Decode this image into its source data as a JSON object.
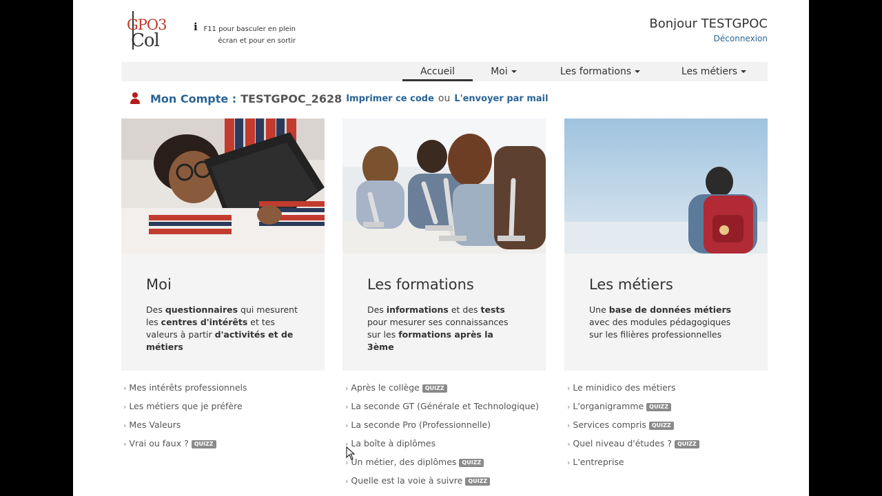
{
  "logo": {
    "line1": "GPO3",
    "line2": "Col"
  },
  "info": {
    "icon": "info-icon",
    "text": "F11 pour basculer en plein écran et pour en sortir"
  },
  "user": {
    "greeting": "Bonjour TESTGPOC",
    "logout_label": "Déconnexion"
  },
  "nav": {
    "accueil": "Accueil",
    "moi": "Moi",
    "formations": "Les formations",
    "metiers": "Les métiers"
  },
  "account": {
    "label": "Mon Compte :",
    "code": "TESTGPOC_2628",
    "print_link": "Imprimer ce code",
    "or": "ou",
    "mail_link": "L'envoyer par mail"
  },
  "cards": [
    {
      "title": "Moi",
      "desc": [
        {
          "t": "Des ",
          "b": false
        },
        {
          "t": "questionnaires",
          "b": true
        },
        {
          "t": " qui mesurent les ",
          "b": false
        },
        {
          "t": "centres d'intérêts",
          "b": true
        },
        {
          "t": " et tes valeurs à partir ",
          "b": false
        },
        {
          "t": "d'activités et de métiers",
          "b": true
        }
      ],
      "links": [
        {
          "label": "Mes intérêts professionnels",
          "quizz": false
        },
        {
          "label": "Les métiers que je préfère",
          "quizz": false
        },
        {
          "label": "Mes Valeurs",
          "quizz": false
        },
        {
          "label": "Vrai ou faux ?",
          "quizz": true
        }
      ]
    },
    {
      "title": "Les formations",
      "desc": [
        {
          "t": "Des ",
          "b": false
        },
        {
          "t": "informations",
          "b": true
        },
        {
          "t": " et des ",
          "b": false
        },
        {
          "t": "tests",
          "b": true
        },
        {
          "t": " pour mesurer ses connaissances sur les ",
          "b": false
        },
        {
          "t": "formations après la 3ème",
          "b": true
        }
      ],
      "links": [
        {
          "label": "Après le collège",
          "quizz": true
        },
        {
          "label": "La seconde GT (Générale et Technologique)",
          "quizz": false
        },
        {
          "label": "La seconde Pro (Professionnelle)",
          "quizz": false
        },
        {
          "label": "La boîte à diplômes",
          "quizz": false
        },
        {
          "label": "Un métier, des diplômes",
          "quizz": true
        },
        {
          "label": "Quelle est la voie à suivre",
          "quizz": true
        }
      ]
    },
    {
      "title": "Les métiers",
      "desc": [
        {
          "t": "Une ",
          "b": false
        },
        {
          "t": "base de données métiers",
          "b": true
        },
        {
          "t": " avec des modules pédagogiques sur les filières professionnelles",
          "b": false
        }
      ],
      "links": [
        {
          "label": "Le minidico des métiers",
          "quizz": false
        },
        {
          "label": "L'organigramme",
          "quizz": true
        },
        {
          "label": "Services compris",
          "quizz": true
        },
        {
          "label": "Quel niveau d'études ?",
          "quizz": true
        },
        {
          "label": "L'entreprise",
          "quizz": false
        }
      ]
    }
  ],
  "badge_label": "QUIZZ",
  "colors": {
    "link": "#2a6496",
    "accent_red": "#b71c1c",
    "card_bg": "#f4f4f4"
  }
}
